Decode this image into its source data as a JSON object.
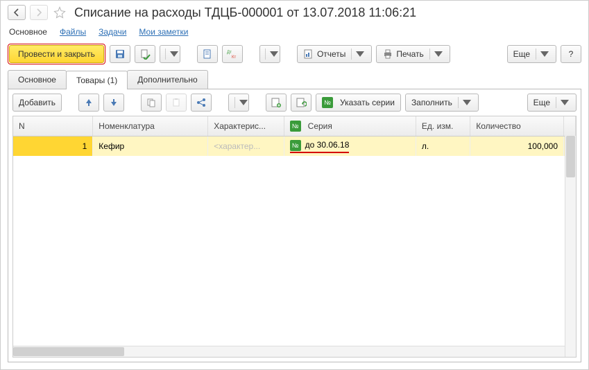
{
  "header": {
    "title": "Списание на расходы ТДЦБ-000001 от 13.07.2018 11:06:21"
  },
  "topnav": {
    "main": "Основное",
    "files": "Файлы",
    "tasks": "Задачи",
    "notes": "Мои заметки"
  },
  "toolbar": {
    "post_and_close": "Провести и закрыть",
    "reports": "Отчеты",
    "print": "Печать",
    "more": "Еще",
    "help": "?"
  },
  "tabs": {
    "main": "Основное",
    "goods": "Товары (1)",
    "extra": "Дополнительно"
  },
  "tab_toolbar": {
    "add": "Добавить",
    "series": "Указать серии",
    "fill": "Заполнить",
    "more": "Еще"
  },
  "grid": {
    "columns": {
      "n": "N",
      "nomenclature": "Номенклатура",
      "characteristic": "Характерис...",
      "series": "Серия",
      "unit": "Ед. изм.",
      "quantity": "Количество"
    },
    "rows": [
      {
        "n": "1",
        "nomenclature": "Кефир",
        "characteristic_placeholder": "<характер...",
        "series": "до 30.06.18",
        "unit": "л.",
        "quantity": "100,000"
      }
    ]
  }
}
